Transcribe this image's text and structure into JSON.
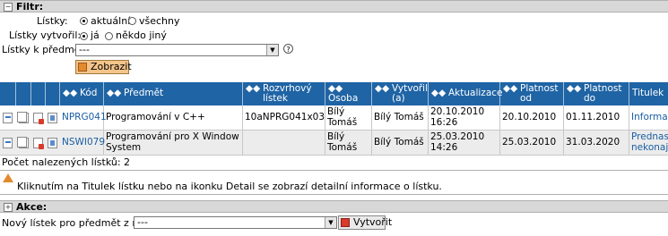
{
  "filter": {
    "section_title": "Filtr:",
    "toggle": "−",
    "listky_label": "Lístky:",
    "listky_options": [
      "aktuální",
      "všechny"
    ],
    "vytvoril_label": "Lístky vytvořil:",
    "vytvoril_options": [
      "já",
      "někdo jiný"
    ],
    "predmet_label": "Lístky k předmětu:",
    "predmet_value": "---",
    "help_icon": "?",
    "submit_label": "Zobrazit"
  },
  "table": {
    "headers": [
      "Kód",
      "Předmět",
      "Rozvrhový lístek",
      "Osoba",
      "Vytvořil (a)",
      "Aktualizace",
      "Platnost od",
      "Platnost do",
      "Titulek"
    ],
    "sort_arrows": "◆◆",
    "rows": [
      {
        "kod": "NPRG041",
        "predmet": "Programování v C++",
        "rozvrhovy": "10aNPRG041x03",
        "osoba_line1": "Bílý",
        "osoba_line2": "Tomáš",
        "vytvoril": "Bílý Tomáš",
        "aktualizace_date": "20.10.2010",
        "aktualizace_time": "16:26",
        "platnost_od": "20.10.2010",
        "platnost_do": "01.11.2010",
        "titulek_line1": "Informace",
        "titulek_line2": ""
      },
      {
        "kod": "NSWI079",
        "predmet": "Programování pro X Window",
        "predmet_line2": "System",
        "rozvrhovy": "",
        "osoba_line1": "Bílý",
        "osoba_line2": "Tomáš",
        "vytvoril": "Bílý Tomáš",
        "aktualizace_date": "25.03.2010",
        "aktualizace_time": "14:26",
        "platnost_od": "25.03.2010",
        "platnost_do": "31.03.2020",
        "titulek_line1": "Prednask",
        "titulek_line2": "nekonaji"
      }
    ],
    "count_text": "Počet nalezených lístků: 2"
  },
  "info": {
    "text": "Kliknutím na Titulek lístku nebo na ikonku Detail se zobrazí detailní informace o lístku."
  },
  "akce": {
    "section_title": "Akce:",
    "toggle": "+",
    "novy_label": "Nový lístek pro předmět z rozvrhu:",
    "novy_value": "---",
    "create_label": "Vytvořit"
  },
  "colors": {
    "header_bg": "#1f64a5",
    "link": "#1a5da3",
    "button_bg": "#f4c48a"
  }
}
